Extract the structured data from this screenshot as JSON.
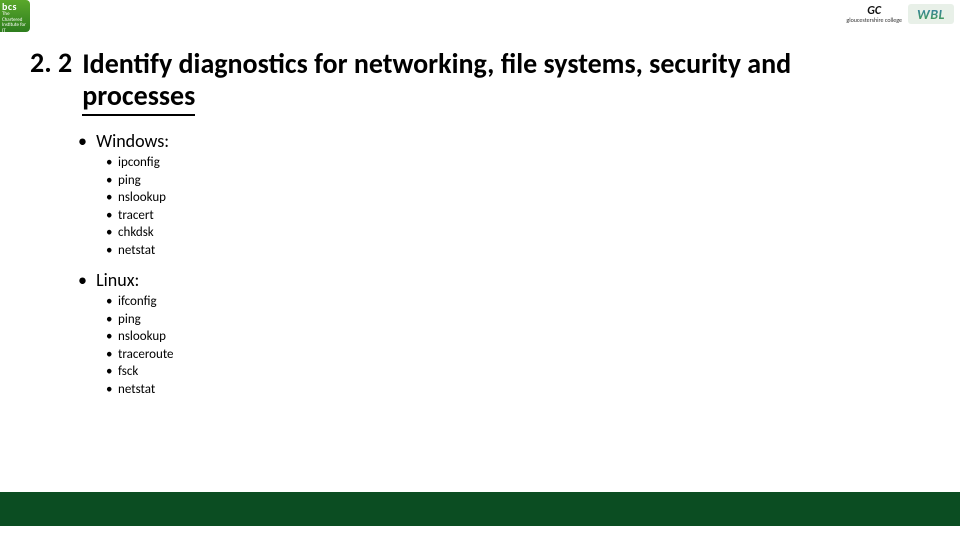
{
  "logos": {
    "bcs": {
      "initials": "bcs",
      "tagline": "The Chartered Institute for IT"
    },
    "gc": {
      "initials": "GC",
      "name": "gloucestershire college"
    },
    "wbl": {
      "text": "WBL"
    }
  },
  "heading": {
    "number": "2. 2",
    "line1": "Identify diagnostics for networking, file systems, security and",
    "line2": "processes"
  },
  "sections": [
    {
      "label": "Windows:",
      "items": [
        "ipconfig",
        "ping",
        "nslookup",
        "tracert",
        "chkdsk",
        "netstat"
      ]
    },
    {
      "label": "Linux:",
      "items": [
        "ifconfig",
        "ping",
        "nslookup",
        "traceroute",
        "fsck",
        "netstat"
      ]
    }
  ]
}
